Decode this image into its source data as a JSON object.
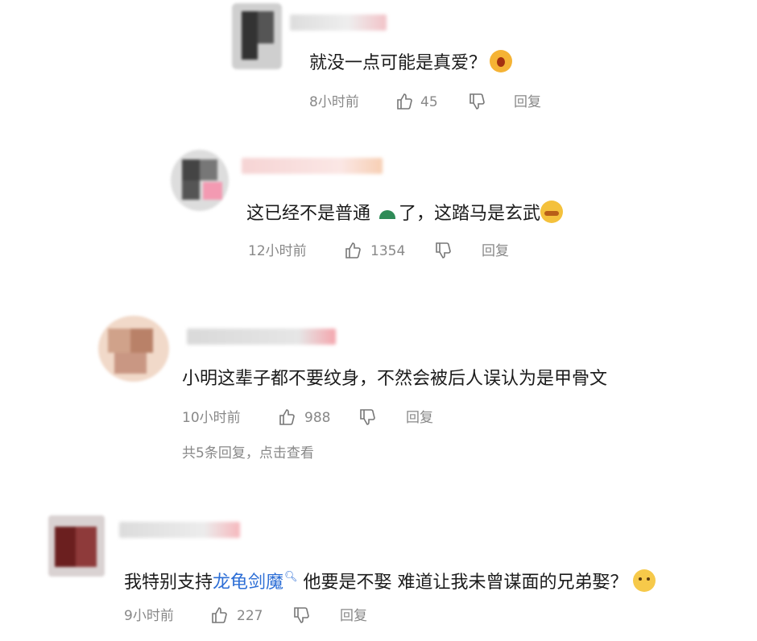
{
  "comments": [
    {
      "text": "就没一点可能是真爱？",
      "time": "8小时前",
      "likes": "45",
      "reply_label": "回复"
    },
    {
      "text_a": "这已经不是普通",
      "text_b": "了，这踏马是玄武",
      "time": "12小时前",
      "likes": "1354",
      "reply_label": "回复"
    },
    {
      "text": "小明这辈子都不要纹身，不然会被后人误认为是甲骨文",
      "time": "10小时前",
      "likes": "988",
      "reply_label": "回复",
      "more_replies": "共5条回复，点击查看"
    },
    {
      "text_a": "我特别支持",
      "link": "龙龟剑魔",
      "text_b": " 他要是不娶 难道让我未曾谋面的兄弟娶？",
      "time": "9小时前",
      "likes": "227",
      "reply_label": "回复"
    }
  ],
  "colors": {
    "link": "#2e6fd6",
    "meta": "#888888",
    "text": "#1b1b1b"
  }
}
